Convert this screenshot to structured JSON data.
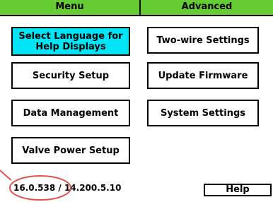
{
  "header": {
    "tabs": [
      {
        "label": "Menu"
      },
      {
        "label": "Advanced"
      }
    ]
  },
  "menu": {
    "left_buttons": [
      {
        "label": "Select Language for Help Displays",
        "selected": true
      },
      {
        "label": "Security Setup"
      },
      {
        "label": "Data Management"
      },
      {
        "label": "Valve Power Setup"
      }
    ],
    "right_buttons": [
      {
        "label": "Two-wire Settings"
      },
      {
        "label": "Update Firmware"
      },
      {
        "label": "System Settings"
      }
    ]
  },
  "footer": {
    "version": "16.0.538 / 14.200.5.10",
    "help_label": "Help"
  },
  "colors": {
    "header": "#66cc33",
    "selected": "#00e5f5",
    "annotation": "#e05050"
  }
}
